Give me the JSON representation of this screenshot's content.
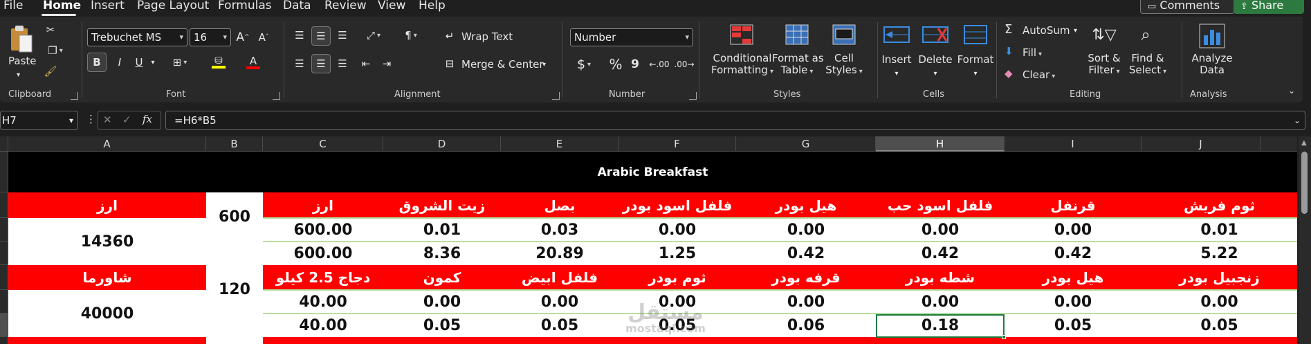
{
  "menu": {
    "items": [
      "File",
      "Home",
      "Insert",
      "Page Layout",
      "Formulas",
      "Data",
      "Review",
      "View",
      "Help"
    ],
    "active": "Home",
    "comments_label": "Comments",
    "share_label": "Share"
  },
  "ribbon": {
    "clipboard": {
      "paste_label": "Paste",
      "group_label": "Clipboard"
    },
    "font": {
      "font_name": "Trebuchet MS",
      "font_size": "16",
      "bold": "B",
      "italic": "I",
      "underline": "U",
      "group_label": "Font",
      "fill_color": "#ffff00",
      "font_color": "#ff0000"
    },
    "alignment": {
      "wrap_text": "Wrap Text",
      "merge_center": "Merge & Center",
      "group_label": "Alignment"
    },
    "number": {
      "format": "Number",
      "currency": "$",
      "percent": "%",
      "comma": "9",
      "inc_decimal": ".00",
      "dec_decimal": ".00",
      "group_label": "Number"
    },
    "styles": {
      "conditional_1": "Conditional",
      "conditional_2": "Formatting",
      "format_table_1": "Format as",
      "format_table_2": "Table",
      "cell_styles_1": "Cell",
      "cell_styles_2": "Styles",
      "group_label": "Styles"
    },
    "cells": {
      "insert": "Insert",
      "delete": "Delete",
      "format": "Format",
      "group_label": "Cells"
    },
    "editing": {
      "autosum": "AutoSum",
      "fill": "Fill",
      "clear": "Clear",
      "sort_1": "Sort &",
      "sort_2": "Filter",
      "find_1": "Find &",
      "find_2": "Select",
      "group_label": "Editing"
    },
    "analysis": {
      "analyze_1": "Analyze",
      "analyze_2": "Data",
      "group_label": "Analysis"
    }
  },
  "formula_bar": {
    "name_box": "H7",
    "formula": "=H6*B5"
  },
  "columns": [
    "A",
    "B",
    "C",
    "D",
    "E",
    "F",
    "G",
    "H",
    "I",
    "J"
  ],
  "selected_column": "H",
  "sheet": {
    "title": "Arabic Breakfast",
    "block1": {
      "name": "ارز",
      "quantity": "600",
      "total": "14360",
      "headers": [
        "ارز",
        "زيت الشروق",
        "بصل",
        "فلفل اسود بودر",
        "هيل بودر",
        "فلفل اسود حب",
        "قرنفل",
        "ثوم فريش"
      ],
      "row1": [
        "600.00",
        "0.01",
        "0.03",
        "0.00",
        "0.00",
        "0.00",
        "0.00",
        "0.01"
      ],
      "row2": [
        "600.00",
        "8.36",
        "20.89",
        "1.25",
        "0.42",
        "0.42",
        "0.42",
        "5.22"
      ]
    },
    "block2": {
      "name": "شاورما",
      "quantity": "120",
      "total": "40000",
      "headers": [
        "دجاج 2.5 كيلو",
        "كمون",
        "فلفل ابيض",
        "ثوم بودر",
        "قرفه بودر",
        "شطه بودر",
        "هيل بودر",
        "زنجبيل بودر"
      ],
      "row1": [
        "40.00",
        "0.00",
        "0.00",
        "0.00",
        "0.00",
        "0.00",
        "0.00",
        "0.00"
      ],
      "row2": [
        "40.00",
        "0.05",
        "0.05",
        "0.05",
        "0.06",
        "0.18",
        "0.05",
        "0.05"
      ]
    },
    "watermark_1": "مستقل",
    "watermark_2": "mostaql.com"
  }
}
